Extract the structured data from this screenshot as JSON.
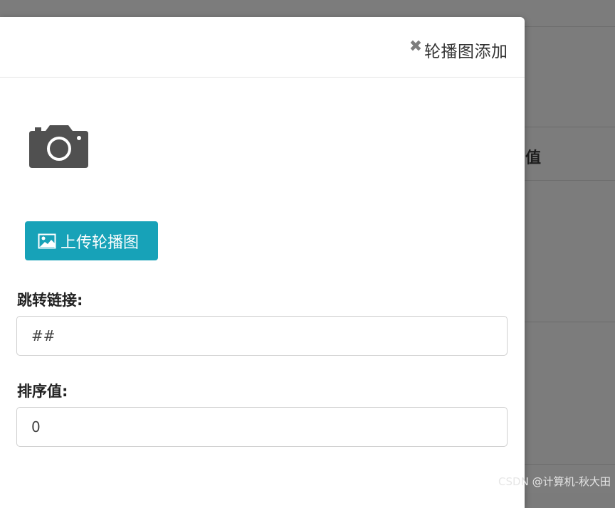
{
  "background": {
    "column_header": "值"
  },
  "modal": {
    "title": "轮播图添加",
    "close_symbol": "✖",
    "preview_icon": "camera-icon",
    "upload_button_label": "上传轮播图",
    "upload_button_icon": "image-icon",
    "fields": [
      {
        "label": "跳转链接:",
        "value": "##"
      },
      {
        "label": "排序值:",
        "value": "0"
      }
    ],
    "colors": {
      "accent": "#17a2b8",
      "overlay": "#7b7b7b"
    }
  },
  "watermark": "CSDN @计算机-秋大田"
}
